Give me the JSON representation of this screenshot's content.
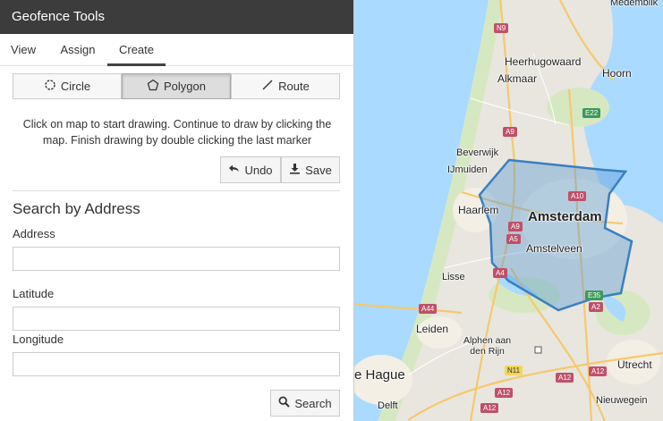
{
  "app": {
    "title": "Geofence Tools"
  },
  "tabs": [
    {
      "label": "View"
    },
    {
      "label": "Assign"
    },
    {
      "label": "Create",
      "active": true
    }
  ],
  "modes": [
    {
      "label": "Circle",
      "icon": "circle-icon"
    },
    {
      "label": "Polygon",
      "icon": "polygon-icon",
      "active": true
    },
    {
      "label": "Route",
      "icon": "route-line-icon"
    }
  ],
  "instructions": "Click on map to start drawing. Continue to draw by clicking the map. Finish drawing by double clicking the last marker",
  "actions": {
    "undo_label": "Undo",
    "save_label": "Save",
    "undo_icon": "undo-arrow-icon",
    "save_icon": "download-icon"
  },
  "search": {
    "heading": "Search by Address",
    "address_label": "Address",
    "address_value": "",
    "latitude_label": "Latitude",
    "latitude_value": "",
    "longitude_label": "Longitude",
    "longitude_value": "",
    "button_label": "Search",
    "button_icon": "search-icon"
  },
  "map": {
    "places": {
      "amsterdam": "Amsterdam",
      "haarlem": "Haarlem",
      "amstelveen": "Amstelveen",
      "alkmaar": "Alkmaar",
      "heerhugowaard": "Heerhugowaard",
      "hoorn": "Hoorn",
      "beverwijk": "Beverwijk",
      "ijmuiden": "IJmuiden",
      "lisse": "Lisse",
      "leiden": "Leiden",
      "alphen": "Alphen aan\nden Rijn",
      "hague": "e Hague",
      "utrecht": "Utrecht",
      "delft": "Delft",
      "nieuwegein": "Nieuwegein",
      "medemblik": "Medemblik"
    },
    "roads": [
      "N9",
      "A9",
      "E22",
      "A10",
      "A9",
      "A5",
      "A4",
      "E35",
      "A2",
      "A44",
      "N11",
      "A12",
      "A12",
      "A12",
      "A12"
    ],
    "colors": {
      "water": "#aadaff",
      "land": "#e8e6df",
      "urban": "#f0ede6",
      "green": "#cfe6b3",
      "polygon_fill": "#5b9bd5",
      "polygon_stroke": "#3a7fc1"
    }
  }
}
